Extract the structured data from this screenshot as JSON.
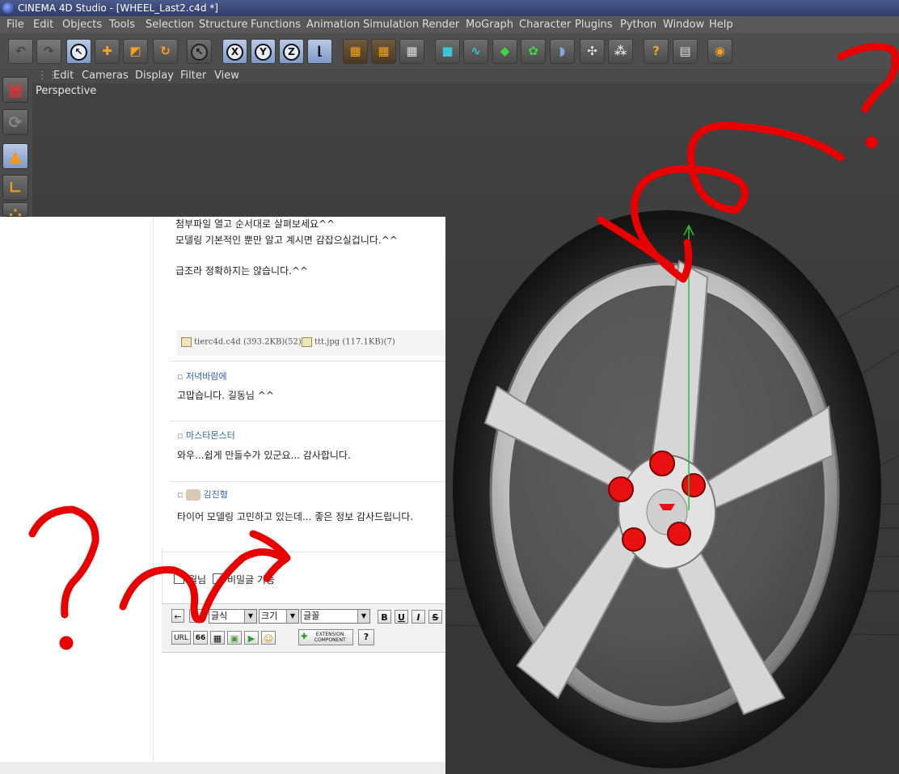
{
  "window": {
    "title": "CINEMA 4D Studio - [WHEEL_Last2.c4d *]"
  },
  "menubar": [
    "File",
    "Edit",
    "Objects",
    "Tools",
    "Selection",
    "Structure",
    "Functions",
    "Animation",
    "Simulation",
    "Render",
    "MoGraph",
    "Character",
    "Plugins",
    "Python",
    "Window",
    "Help"
  ],
  "toolbar": {
    "axis_x": "X",
    "axis_y": "Y",
    "axis_z": "Z",
    "help": "?"
  },
  "viewport": {
    "menu": [
      "Edit",
      "Cameras",
      "Display",
      "Filter",
      "View"
    ],
    "label": "Perspective"
  },
  "post": {
    "line1": "첨부파일 열고 순서대로 살펴보세요^^",
    "line2": "모델링 기본적인 뿐만 알고 계시면 감잡으실겁니다.^^",
    "line3": "급조라 정확하지는 않습니다.^^",
    "attachments": [
      "tierc4d.c4d (393.2KB)(52)",
      "ttt.jpg (117.1KB)(7)"
    ]
  },
  "comments": [
    {
      "author": "저녁바람에",
      "text": "고맙습니다. 길동님 ^^"
    },
    {
      "author": "마스타몬스터",
      "text": "와우...쉽게 만들수가 있군요... 감사합니다."
    },
    {
      "author": "김진형",
      "text": "타이어 모델링 고민하고 있는데... 좋은 정보 감사드립니다."
    }
  ],
  "reply": {
    "checkbox1": "월님",
    "checkbox2": "비밀글 기능",
    "font_style": "글식",
    "size": "크기",
    "font": "글꼴",
    "bold": "B",
    "underline": "U",
    "italic": "I",
    "strike": "S",
    "url": "URL",
    "quote": "66",
    "ext1": "EXTENSION",
    "ext2": "COMPONENT",
    "help": "?"
  },
  "colors": {
    "accent_orange": "#f29a1c",
    "scribble_red": "#e80000",
    "axis_green": "#2fc02f"
  }
}
